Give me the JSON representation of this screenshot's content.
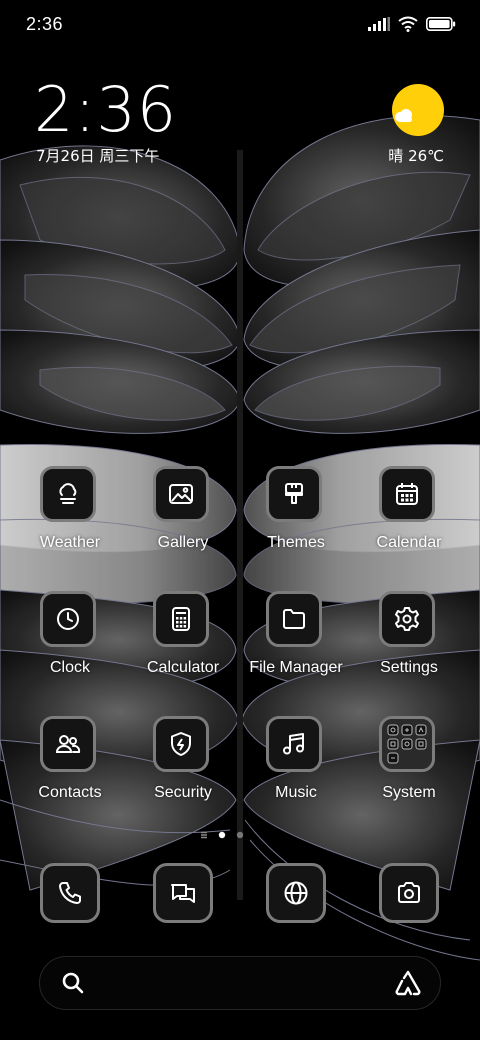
{
  "status_bar": {
    "time": "2:36",
    "icons": [
      "signal-icon",
      "wifi-icon",
      "battery-icon"
    ]
  },
  "clock_widget": {
    "time": "2:36",
    "date": "7月26日 周三下午",
    "weather_icon": "sun-cloud-icon",
    "weather": "晴 26℃"
  },
  "apps": [
    {
      "label": "Weather",
      "icon": "weather-icon"
    },
    {
      "label": "Gallery",
      "icon": "gallery-icon"
    },
    {
      "label": "Themes",
      "icon": "themes-icon"
    },
    {
      "label": "Calendar",
      "icon": "calendar-icon"
    },
    {
      "label": "Clock",
      "icon": "clock-icon"
    },
    {
      "label": "Calculator",
      "icon": "calculator-icon"
    },
    {
      "label": "File Manager",
      "icon": "folder-icon"
    },
    {
      "label": "Settings",
      "icon": "gear-icon"
    },
    {
      "label": "Contacts",
      "icon": "contacts-icon"
    },
    {
      "label": "Security",
      "icon": "shield-icon"
    },
    {
      "label": "Music",
      "icon": "music-note-icon"
    },
    {
      "label": "System",
      "icon": "system-folder-icon"
    }
  ],
  "page_indicator": {
    "pages": 2,
    "current": 1
  },
  "dock": [
    "phone-icon",
    "messages-icon",
    "browser-icon",
    "camera-icon"
  ],
  "search_bar": {
    "icon": "search-icon",
    "assistant_icon": "assistant-icon"
  },
  "colors": {
    "background": "#000000",
    "tile_border": "#7c7c7c",
    "sun": "#ffd00a"
  }
}
